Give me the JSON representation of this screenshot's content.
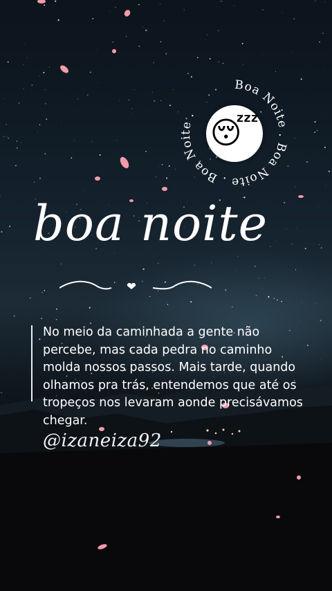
{
  "badge": {
    "ring_text": "Boa Noite . Boa Noite . Boa Noite .",
    "emoji": "😴",
    "icon": "sleeping-face-emoji"
  },
  "title": "boa noite",
  "quote": "No meio da caminhada a gente não percebe, mas cada pedra no caminho molda nossos passos. Mais tarde, quando olhamos pra trás, entendemos que até os tropeços nos levaram aonde precisávamos chegar.",
  "handle": "@izaneiza92",
  "colors": {
    "text": "#ffffff",
    "petal": "#f49aa8",
    "sky_top": "#0c141c",
    "ground": "#070709"
  }
}
